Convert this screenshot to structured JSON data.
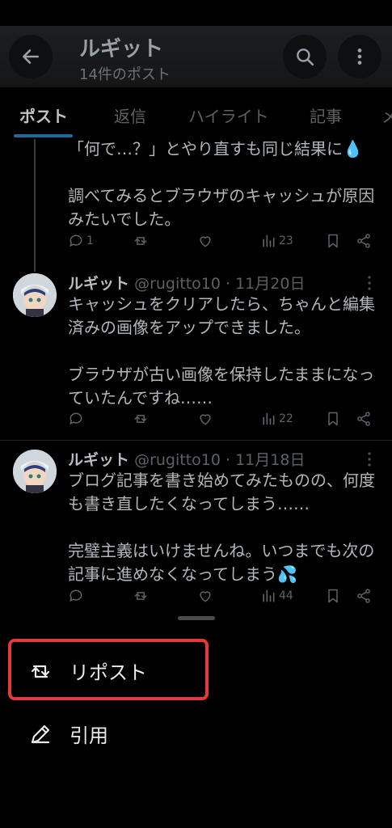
{
  "header": {
    "back_icon": "arrow-left-icon",
    "title": "ルギット",
    "subtitle": "14件のポスト",
    "search_icon": "search-icon",
    "more_icon": "more-vertical-icon"
  },
  "tabs": [
    {
      "label": "ポスト",
      "active": true
    },
    {
      "label": "返信",
      "active": false
    },
    {
      "label": "ハイライト",
      "active": false
    },
    {
      "label": "記事",
      "active": false
    },
    {
      "label": "メ",
      "active": false
    }
  ],
  "posts": [
    {
      "text": "「何で…？」とやり直すも同じ結果に💧\n\n調べてみるとブラウザのキャッシュが原因みたいでした。",
      "replies": "1",
      "views": "23"
    },
    {
      "name": "ルギット",
      "handle": "@rugitto10",
      "date": "· 11月20日",
      "text": "キャッシュをクリアしたら、ちゃんと編集済みの画像をアップできました。\n\nブラウザが古い画像を保持したままになっていたんですね……",
      "views": "22"
    },
    {
      "name": "ルギット",
      "handle": "@rugitto10",
      "date": "· 11月18日",
      "text": "ブログ記事を書き始めてみたものの、何度も書き直したくなってしまう……\n\n完璧主義はいけませんね。いつまでも次の記事に進めなくなってしまう💦",
      "views": "44"
    }
  ],
  "sheet": {
    "repost_label": "リポスト",
    "quote_label": "引用"
  },
  "colors": {
    "background": "#000000",
    "accent": "#1d9bf0",
    "highlight": "#e53935"
  }
}
